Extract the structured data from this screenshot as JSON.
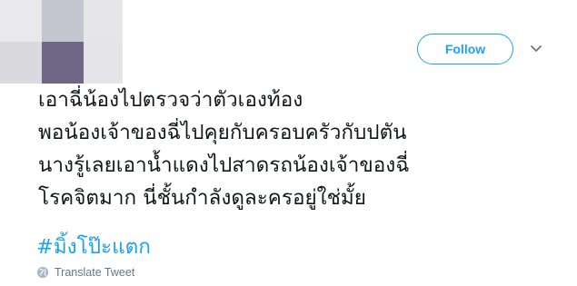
{
  "header": {
    "avatar_colors": [
      "#e9e9ec",
      "#c5c5d0",
      "#e6e6e9",
      "#f4f4f5",
      "#d9d9de",
      "#6e6886",
      "#e4e4e8",
      "#f7f7f8"
    ],
    "follow_label": "Follow",
    "more_icon": "chevron-down-icon"
  },
  "tweet": {
    "text": "เอาฉี่น้องไปตรวจว่าตัวเองท้อง\nพอน้องเจ้าของฉี่ไปคุยกับครอบครัวกับปตัน\nนางรู้เลยเอาน้ำแดงไปสาดรถน้องเจ้าของฉี่\nโรคจิตมาก นี่ชั้นกำลังดูละครอยู่ใช่มั้ย",
    "hashtag": "#มิ้งโป๊ะแตก",
    "translate_label": "Translate Tweet",
    "translate_icon": "globe-icon",
    "accent_color": "#1da1f2"
  }
}
